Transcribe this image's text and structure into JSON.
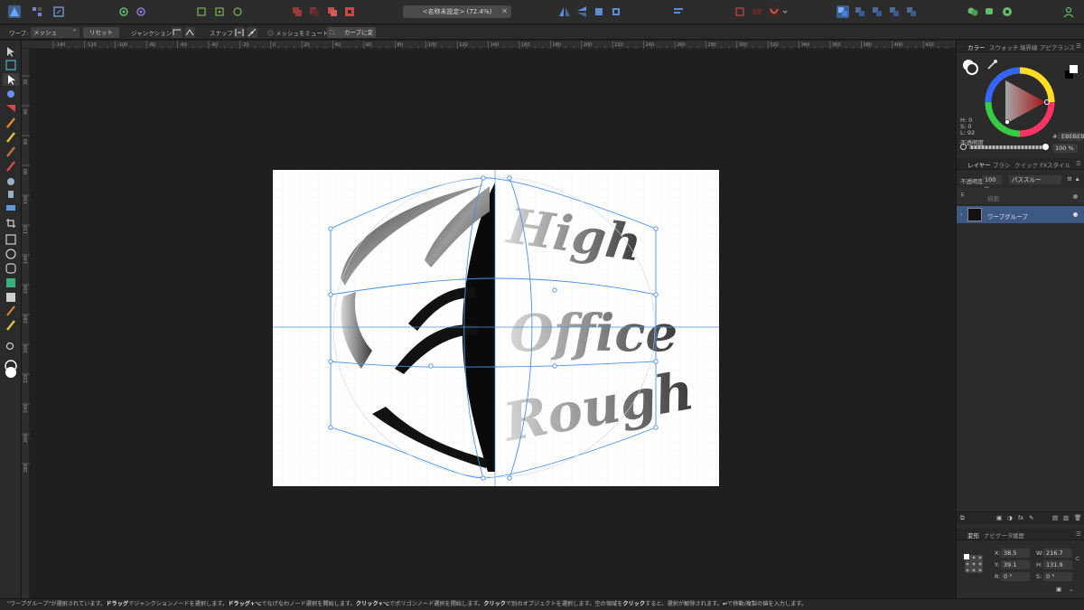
{
  "document": {
    "title": "<名称未設定> (72.4%)"
  },
  "context_bar": {
    "warp_label": "ワープ:",
    "warp_value": "メッシュ",
    "reset_label": "リセット",
    "junction_label": "ジャンクション:",
    "snap_label": "スナップ:",
    "mute_mesh_label": "メッシュをミュート",
    "convert_curve_label": "カーブに変換"
  },
  "ruler": {
    "h_ticks": [
      "-140",
      "-120",
      "-100",
      "-80",
      "-60",
      "-40",
      "-20",
      "0",
      "20",
      "40",
      "60",
      "80",
      "100",
      "120",
      "140",
      "160",
      "180",
      "200",
      "220",
      "240",
      "260",
      "280",
      "300",
      "320",
      "340",
      "360",
      "380",
      "400",
      "420"
    ],
    "v_ticks": [
      "20",
      "40",
      "60",
      "80",
      "100",
      "120",
      "140",
      "160",
      "180",
      "200",
      "220",
      "240",
      "260",
      "280"
    ]
  },
  "artwork": {
    "words": [
      "High",
      "Office",
      "Rough"
    ]
  },
  "color_panel": {
    "tabs": [
      "カラー",
      "スウォッチ",
      "境界線",
      "アピアランス"
    ],
    "h": "H: 0",
    "s": "S: 0",
    "l": "L: 92",
    "hex_label": "#:",
    "hex_value": "EBEBEB",
    "opacity_label": "不透明度",
    "opacity_value": "100 %"
  },
  "layers_panel": {
    "tabs": [
      "レイヤー",
      "ブラシ",
      "クイック FX",
      "スタイル"
    ],
    "opacity_label": "不透明度:",
    "opacity_value": "100 %",
    "blend_mode": "パススルー",
    "layers": [
      {
        "name": "描画",
        "selected": false
      },
      {
        "name": "ワープグループ",
        "selected": true
      }
    ]
  },
  "transform_panel": {
    "tabs": [
      "変形",
      "ナビゲータ",
      "履歴"
    ],
    "x_label": "X:",
    "x_value": "38.5 mm",
    "y_label": "Y:",
    "y_value": "39.1 mm",
    "w_label": "W:",
    "w_value": "216.7 mm",
    "h_label": "H:",
    "h_value": "131.9 mm",
    "r_label": "R:",
    "r_value": "0 °",
    "s_label": "S:",
    "s_value": "0 °"
  },
  "status_bar": {
    "segments": [
      {
        "text": "\"ワープグループ\"が選択されています。",
        "bold": false
      },
      {
        "text": "ドラッグ",
        "bold": true
      },
      {
        "text": "でジャンクションノードを選択します。",
        "bold": false
      },
      {
        "text": "ドラッグ+⌥",
        "bold": true
      },
      {
        "text": "でなげなわノード選択を開始します。",
        "bold": false
      },
      {
        "text": "クリック+⌥",
        "bold": true
      },
      {
        "text": "でポリゴンノード選択を開始します。",
        "bold": false
      },
      {
        "text": "クリック",
        "bold": true
      },
      {
        "text": "で別のオブジェクトを選択します。空の領域を",
        "bold": false
      },
      {
        "text": "クリック",
        "bold": true
      },
      {
        "text": "すると、選択が解除されます。",
        "bold": false
      },
      {
        "text": "↩︎",
        "bold": true
      },
      {
        "text": "で移動/複製の値を入力します。",
        "bold": false
      }
    ]
  },
  "colors": {
    "accent": "#3f5f8f",
    "selection_blue": "#4a90e2",
    "canvas_bg": "#1f1f1f",
    "panel_bg": "#2b2b2b",
    "layer_selected": "#3e5884"
  }
}
